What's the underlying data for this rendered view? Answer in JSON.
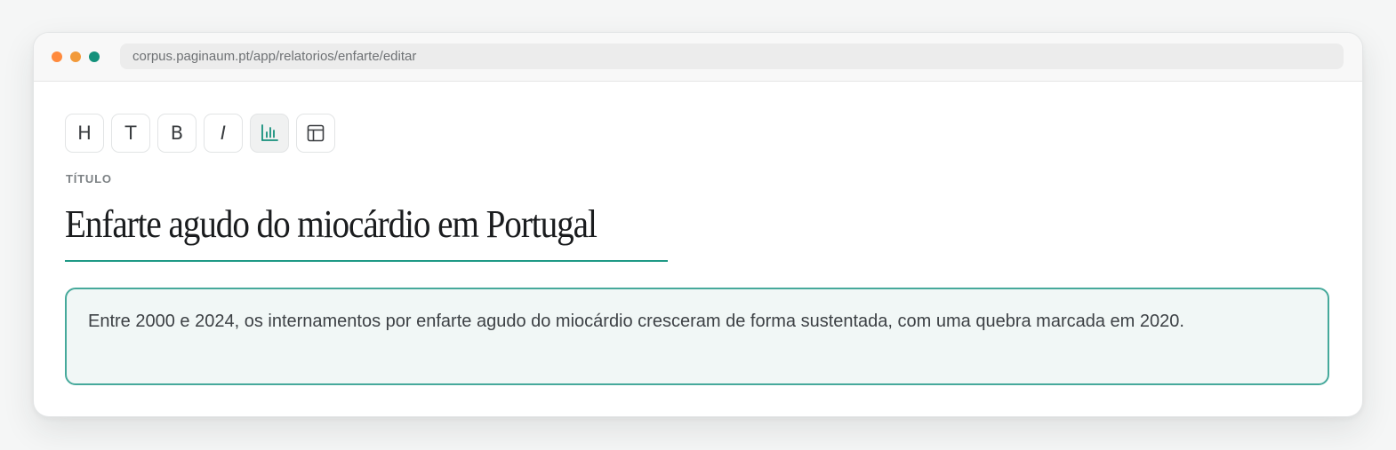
{
  "browser": {
    "url": "corpus.paginaum.pt/app/relatorios/enfarte/editar",
    "dots": [
      {
        "name": "close",
        "color": "#ff8a3d"
      },
      {
        "name": "minimize",
        "color": "#f29a3a"
      },
      {
        "name": "maximize",
        "color": "#13917b"
      }
    ]
  },
  "toolbar": {
    "buttons": [
      {
        "id": "heading",
        "glyph": "H",
        "icon": "heading-icon"
      },
      {
        "id": "text",
        "glyph": "T",
        "icon": "text-icon"
      },
      {
        "id": "bold",
        "glyph": "B",
        "icon": "bold-icon"
      },
      {
        "id": "italic",
        "glyph": "I",
        "icon": "italic-icon"
      },
      {
        "id": "chart",
        "glyph": "",
        "icon": "bar-chart-icon",
        "active": true
      },
      {
        "id": "table",
        "glyph": "",
        "icon": "table-icon"
      }
    ]
  },
  "editor": {
    "title_label": "TÍTULO",
    "title_value": "Enfarte agudo do miocárdio em Portugal",
    "summary": "Entre 2000 e 2024, os internamentos por enfarte agudo do miocárdio cresceram de forma sustentada, com uma quebra marcada em 2020."
  },
  "colors": {
    "accent": "#1f9a86",
    "summary_border": "#46a99b",
    "summary_bg": "#f1f7f6"
  }
}
